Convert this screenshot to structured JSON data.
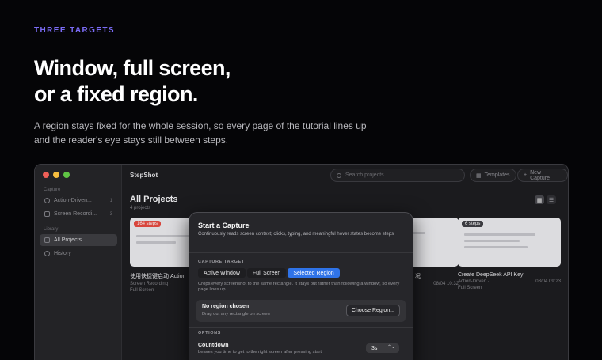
{
  "hero": {
    "eyebrow": "THREE TARGETS",
    "headline_line1": "Window, full screen,",
    "headline_line2": "or a fixed region.",
    "lede_line1": "A region stays fixed for the whole session, so every page of the tutorial lines up",
    "lede_line2": "and the reader's eye stays still between steps."
  },
  "app": {
    "title": "StepShot",
    "search_placeholder": "Search projects",
    "templates_label": "Templates",
    "new_capture_label": "New Capture",
    "sidebar": {
      "capture_section": "Capture",
      "capture_items": [
        {
          "label": "Action-Driven...",
          "count": "1",
          "icon": "cursor-icon"
        },
        {
          "label": "Screen Recordi...",
          "count": "3",
          "icon": "video-icon"
        }
      ],
      "library_section": "Library",
      "library_items": [
        {
          "label": "All Projects",
          "icon": "grid-icon"
        },
        {
          "label": "History",
          "icon": "clock-icon"
        }
      ]
    },
    "main": {
      "title": "All Projects",
      "subtitle": "4 projects",
      "cards": [
        {
          "badge": "164 steps",
          "title": "使用快捷键启动 Action",
          "meta1": "Screen Recording ·",
          "meta2": "Full Screen",
          "date": ""
        },
        {
          "badge": "",
          "title": "况",
          "meta1": "",
          "meta2": "",
          "date": "08/04 10:32"
        },
        {
          "badge": "6 steps",
          "title": "Create DeepSeek API Key",
          "meta1": "Action-Driven ·",
          "meta2": "Full Screen",
          "date": "08/04 09:23"
        }
      ]
    },
    "modal": {
      "title": "Start a Capture",
      "description": "Continuously reads screen context; clicks, typing, and meaningful hover states become steps",
      "target_section": "CAPTURE TARGET",
      "targets": [
        "Active Window",
        "Full Screen",
        "Selected Region"
      ],
      "selected_target": "Selected Region",
      "target_help": "Crops every screenshot to the same rectangle. It stays put rather than following a window, so every page lines up.",
      "region_title": "No region chosen",
      "region_sub": "Drag out any rectangle on screen",
      "choose_region_label": "Choose Region...",
      "options_section": "OPTIONS",
      "countdown_label": "Countdown",
      "countdown_sub": "Leaves you time to get to the right screen after pressing start",
      "countdown_value": "3s"
    }
  },
  "colors": {
    "accent": "#7b6cf6",
    "selected": "#2f73e8",
    "badge_red": "#d8453c"
  }
}
